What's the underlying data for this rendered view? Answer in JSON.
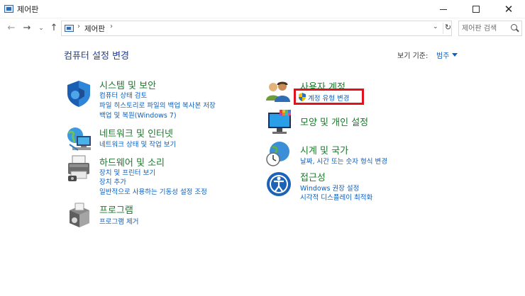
{
  "window": {
    "title": "제어판",
    "minimize_glyph": "—",
    "maximize_glyph": "☐",
    "close_glyph": "✕"
  },
  "nav": {
    "back_glyph": "←",
    "forward_glyph": "→",
    "recent_glyph": "⌄",
    "up_glyph": "↑",
    "breadcrumb": "제어판",
    "breadcrumb_sep": "›",
    "dropdown_glyph": "⌄",
    "refresh_glyph": "↻",
    "search_placeholder": "제어판 검색"
  },
  "main": {
    "title": "컴퓨터 설정 변경",
    "view_by_label": "보기 기준:",
    "view_by_value": "범주"
  },
  "categories": {
    "system_security": {
      "icon": "shield-icon",
      "title": "시스템 및 보안",
      "links": [
        "컴퓨터 상태 검토",
        "파일 히스토리로 파일의 백업 복사본 저장",
        "백업 및 복원(Windows 7)"
      ]
    },
    "network": {
      "icon": "network-globe-icon",
      "title": "네트워크 및 인터넷",
      "links": [
        "네트워크 상태 및 작업 보기"
      ]
    },
    "hardware_sound": {
      "icon": "printer-icon",
      "title": "하드웨어 및 소리",
      "links": [
        "장치 및 프린터 보기",
        "장치 추가",
        "일반적으로 사용하는 기동성 설정 조정"
      ]
    },
    "programs": {
      "icon": "programs-box-icon",
      "title": "프로그램",
      "links": [
        "프로그램 제거"
      ]
    },
    "user_accounts": {
      "icon": "users-icon",
      "title": "사용자 계정",
      "links": [
        "계정 유형 변경"
      ]
    },
    "appearance": {
      "icon": "monitor-palette-icon",
      "title": "모양 및 개인 설정",
      "links": []
    },
    "clock_region": {
      "icon": "clock-globe-icon",
      "title": "시계 및 국가",
      "links": [
        "날짜, 시간 또는 숫자 형식 변경"
      ]
    },
    "ease_of_access": {
      "icon": "ease-of-access-icon",
      "title": "접근성",
      "links": [
        "Windows 권장 설정",
        "시각적 디스플레이 최적화"
      ]
    }
  },
  "colors": {
    "category_title": "#1a7a2a",
    "link": "#0a5fc0",
    "page_title": "#1e3f9c",
    "highlight_box": "#e0121b"
  }
}
